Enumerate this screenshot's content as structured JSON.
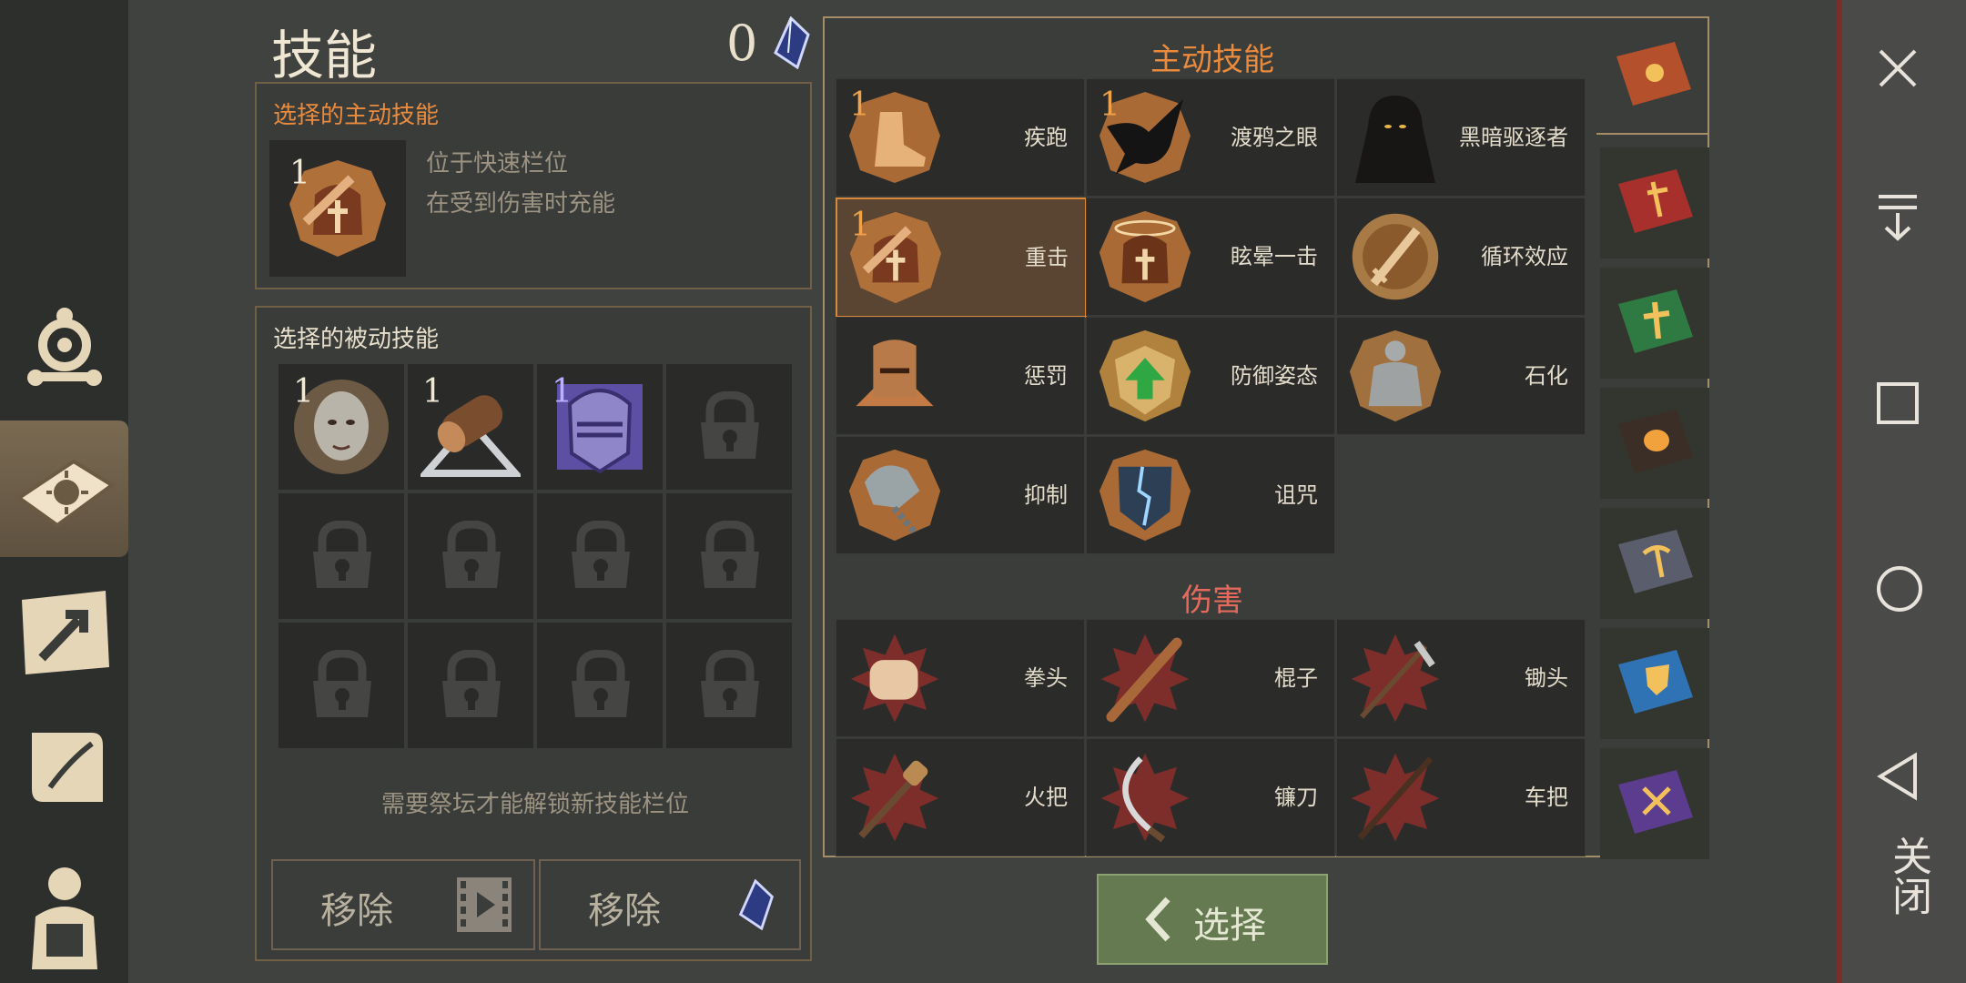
{
  "header": {
    "title": "技能",
    "crystal_count": "0"
  },
  "active_selected": {
    "label": "选择的主动技能",
    "skill_level": "1",
    "desc_line1": "位于快速栏位",
    "desc_line2": "在受到伤害时充能"
  },
  "passive_selected": {
    "label": "选择的被动技能",
    "slots": [
      {
        "level": "1",
        "icon": "head-icon",
        "color": "#8b8d8a"
      },
      {
        "level": "1",
        "icon": "log-icon",
        "color": "#7a4d2f"
      },
      {
        "level": "1",
        "icon": "helmet-icon",
        "color": "#6f5fb6"
      }
    ],
    "footer_hint": "需要祭坛才能解锁新技能栏位"
  },
  "buttons": {
    "remove_video": "移除",
    "remove_crystal": "移除",
    "select": "选择"
  },
  "sections": {
    "active": {
      "title": "主动技能",
      "skills": [
        {
          "name": "疾跑",
          "level": "1",
          "icon": "boot-icon"
        },
        {
          "name": "渡鸦之眼",
          "level": "1",
          "icon": "raven-icon"
        },
        {
          "name": "黑暗驱逐者",
          "level": "",
          "icon": "hooded-figure-icon"
        },
        {
          "name": "重击",
          "level": "1",
          "icon": "helmet-hammer-icon",
          "selected": true
        },
        {
          "name": "眩晕一击",
          "level": "",
          "icon": "stun-helmet-icon"
        },
        {
          "name": "循环效应",
          "level": "",
          "icon": "sword-shield-icon"
        },
        {
          "name": "惩罚",
          "level": "",
          "icon": "knight-helmet-icon"
        },
        {
          "name": "防御姿态",
          "level": "",
          "icon": "shield-arrow-icon"
        },
        {
          "name": "石化",
          "level": "",
          "icon": "stone-figure-icon"
        },
        {
          "name": "抑制",
          "level": "",
          "icon": "chained-hand-icon"
        },
        {
          "name": "诅咒",
          "level": "",
          "icon": "cursed-shield-icon"
        }
      ]
    },
    "damage": {
      "title": "伤害",
      "skills": [
        {
          "name": "拳头",
          "icon": "fist-icon"
        },
        {
          "name": "棍子",
          "icon": "club-icon"
        },
        {
          "name": "锄头",
          "icon": "hoe-icon"
        },
        {
          "name": "火把",
          "icon": "torch-icon"
        },
        {
          "name": "镰刀",
          "icon": "sickle-icon"
        },
        {
          "name": "车把",
          "icon": "shaft-icon"
        }
      ]
    }
  },
  "books": [
    {
      "icon": "sun-book-icon",
      "color": "#b5502c"
    },
    {
      "icon": "dagger-book-icon",
      "color": "#a8302c"
    },
    {
      "icon": "cross-book-icon",
      "color": "#2f7a43"
    },
    {
      "icon": "mask-book-icon",
      "color": "#3b2e26"
    },
    {
      "icon": "pickaxe-book-icon",
      "color": "#5a5d6b"
    },
    {
      "icon": "shield-book-icon",
      "color": "#2f73b5"
    },
    {
      "icon": "arrows-book-icon",
      "color": "#5b3c8e"
    }
  ],
  "system_bar": {
    "close_label": "关闭"
  }
}
